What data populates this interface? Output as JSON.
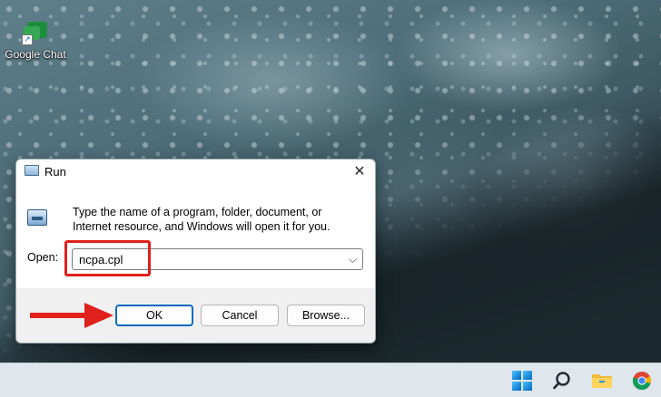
{
  "desktop": {
    "icons": [
      {
        "label": "Google Chat",
        "icon": "google-chat-icon"
      }
    ]
  },
  "run_dialog": {
    "title": "Run",
    "description": "Type the name of a program, folder, document, or Internet resource, and Windows will open it for you.",
    "open_label": "Open:",
    "open_value": "ncpa.cpl",
    "buttons": {
      "ok": "OK",
      "cancel": "Cancel",
      "browse": "Browse..."
    }
  },
  "annotations": {
    "highlight_color": "#e0201c",
    "arrow_color": "#e0201c"
  },
  "taskbar": {
    "items": [
      "windows-start-icon",
      "search-icon",
      "file-explorer-icon",
      "chrome-icon"
    ]
  },
  "colors": {
    "ok_border": "#0067c0",
    "dialog_bg": "#f0f0f0"
  }
}
